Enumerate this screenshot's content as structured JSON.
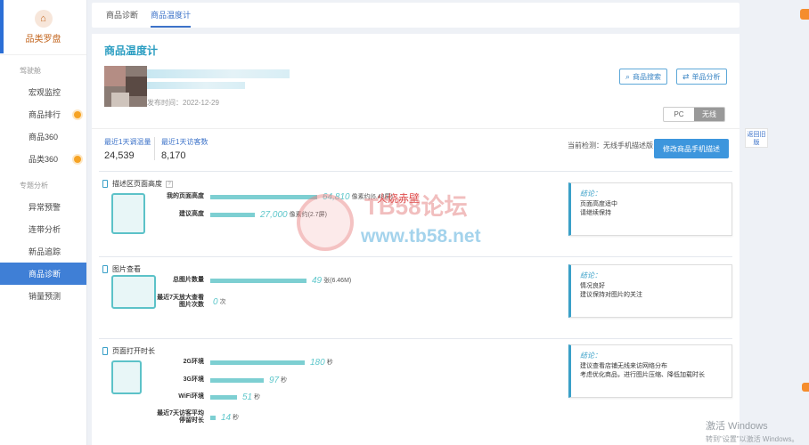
{
  "sidebar": {
    "brand_icon": "⌂",
    "brand": "品类罗盘",
    "groups": [
      {
        "label": "驾驶舱",
        "items": [
          "宏观监控",
          "商品排行",
          "商品360",
          "品类360"
        ]
      },
      {
        "label": "专题分析",
        "items": [
          "异常预警",
          "连带分析",
          "新品追踪",
          "商品诊断",
          "销量预测"
        ]
      }
    ],
    "active_item": "商品诊断"
  },
  "tabs": [
    "商品诊断",
    "商品温度计"
  ],
  "panel": {
    "title": "商品温度计",
    "publish_date": "发布时间：2022-12-29",
    "btn_search": "商品搜索",
    "btn_analysis": "单品分析",
    "device_toggle": [
      "PC",
      "无线"
    ],
    "active_device": "无线",
    "stats": [
      {
        "label": "最近1天调温量",
        "value": "24,539"
      },
      {
        "label": "最近1天访客数",
        "value": "8,170"
      }
    ],
    "detect_text": "当前检测：无线手机描述版",
    "btn_modify": "修改商品手机描述"
  },
  "sections": [
    {
      "title": "描述区页面高度",
      "help": "?",
      "rows": [
        {
          "label": "我的页面高度",
          "value": "64,810",
          "unit": "像素约(6.48屏)",
          "bar": 1.0
        },
        {
          "label": "建议高度",
          "value": "27,000",
          "unit": "像素约(2.7屏)",
          "bar": 0.42
        }
      ],
      "conclusion_title": "结论：",
      "conclusion": [
        "页面高度适中",
        "请继续保持"
      ]
    },
    {
      "title": "图片查看",
      "rows": [
        {
          "label": "总图片数量",
          "value": "49",
          "unit": "张(6.46M)",
          "bar": 0.9
        },
        {
          "label": "最近7天放大查看图片次数",
          "value": "0",
          "unit": "次",
          "bar": 0
        }
      ],
      "conclusion_title": "结论：",
      "conclusion": [
        "情况良好",
        "建议保持对图片的关注"
      ]
    },
    {
      "title": "页面打开时长",
      "rows": [
        {
          "label": "2G环境",
          "value": "180",
          "unit": "秒",
          "bar": 0.88
        },
        {
          "label": "3G环境",
          "value": "97",
          "unit": "秒",
          "bar": 0.5
        },
        {
          "label": "WiFi环境",
          "value": "51",
          "unit": "秒",
          "bar": 0.25
        },
        {
          "label": "最近7天访客平均停留时长",
          "value": "14",
          "unit": "秒",
          "bar": 0.05
        }
      ],
      "conclusion_title": "结论：",
      "conclusion": [
        "建议查看店铺无线来访网络分布",
        "考虑优化商品，进行图片压缩、降低加载时长"
      ]
    }
  ],
  "watermark": {
    "logo": "TB58论坛",
    "url": "www.tb58.net",
    "red": "火烧赤壁"
  },
  "side_float": "返回旧版",
  "windows": {
    "line1": "激活 Windows",
    "line2": "转到\"设置\"以激活 Windows。"
  }
}
